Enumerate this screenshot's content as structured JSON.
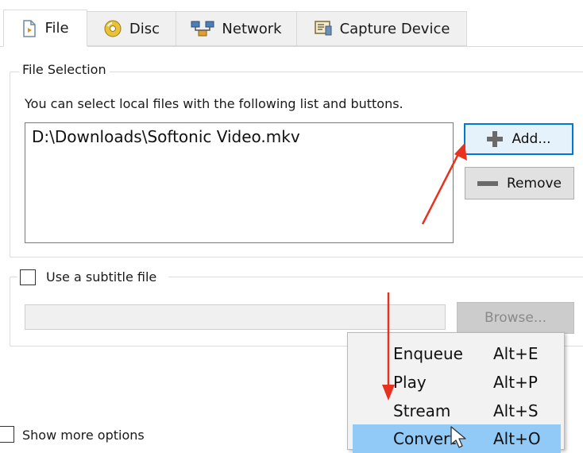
{
  "tabs": [
    {
      "label": "File",
      "icon": "file-icon",
      "active": true
    },
    {
      "label": "Disc",
      "icon": "disc-icon",
      "active": false
    },
    {
      "label": "Network",
      "icon": "network-icon",
      "active": false
    },
    {
      "label": "Capture Device",
      "icon": "capture-device-icon",
      "active": false
    }
  ],
  "file_selection": {
    "title": "File Selection",
    "hint": "You can select local files with the following list and buttons.",
    "files": [
      "D:\\Downloads\\Softonic Video.mkv"
    ],
    "add_label": "Add...",
    "remove_label": "Remove"
  },
  "subtitle": {
    "checkbox_label": "Use a subtitle file",
    "checked": false,
    "browse_label": "Browse..."
  },
  "show_more": {
    "label": "Show more options",
    "checked": false
  },
  "menu": {
    "items": [
      {
        "label": "Enqueue",
        "shortcut": "Alt+E",
        "highlighted": false
      },
      {
        "label": "Play",
        "shortcut": "Alt+P",
        "highlighted": false
      },
      {
        "label": "Stream",
        "shortcut": "Alt+S",
        "highlighted": false
      },
      {
        "label": "Convert",
        "shortcut": "Alt+O",
        "highlighted": true
      }
    ]
  },
  "colors": {
    "annotation_arrow": "#e8321e",
    "menu_highlight": "#91c9f7",
    "focus_border": "#0078d7",
    "add_icon": "#6a6a6a"
  }
}
